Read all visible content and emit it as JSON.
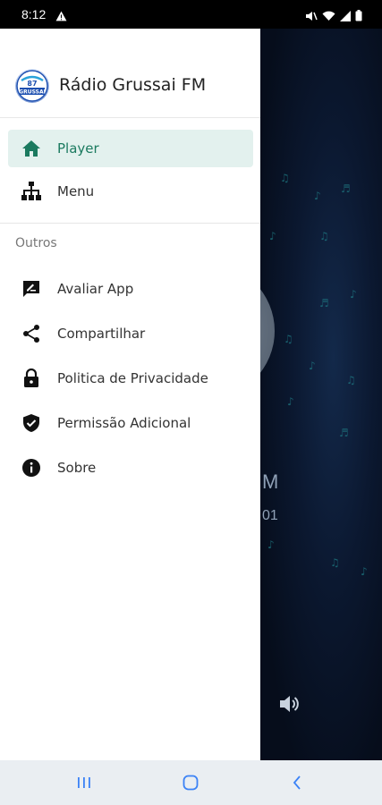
{
  "status": {
    "time": "8:12"
  },
  "drawer": {
    "app_name": "Rádio Grussai FM",
    "logo_text": "GRUSSAI",
    "primary": [
      {
        "label": "Player",
        "icon": "home-icon",
        "active": true
      },
      {
        "label": "Menu",
        "icon": "sitemap-icon",
        "active": false
      }
    ],
    "section_title": "Outros",
    "secondary": [
      {
        "label": "Avaliar App",
        "icon": "rate-review-icon"
      },
      {
        "label": "Compartilhar",
        "icon": "share-icon"
      },
      {
        "label": "Politica de Privacidade",
        "icon": "lock-icon"
      },
      {
        "label": "Permissão Adicional",
        "icon": "verified-user-icon"
      },
      {
        "label": "Sobre",
        "icon": "info-icon"
      }
    ]
  },
  "player": {
    "title_fragment": "M",
    "subtitle_fragment": "01"
  },
  "colors": {
    "accent": "#1b7a5f",
    "active_bg": "#e3f1ee",
    "icon": "#111111",
    "navbar_icon": "#3b82f6"
  }
}
